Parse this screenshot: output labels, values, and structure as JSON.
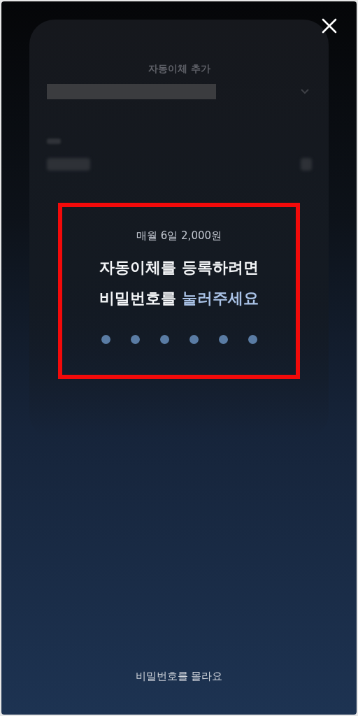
{
  "background_form": {
    "title": "자동이체 추가"
  },
  "pin_prompt": {
    "summary": "매월 6일 2,000원",
    "title_lines": [
      [
        {
          "text": "자동이체를 등록하려면",
          "accent": false
        }
      ],
      [
        {
          "text": "비밀번호를 ",
          "accent": false
        },
        {
          "text": "눌러주세요",
          "accent": true
        }
      ]
    ],
    "pin_dots": [
      {
        "filled": false
      },
      {
        "filled": false
      },
      {
        "filled": false
      },
      {
        "filled": false
      },
      {
        "filled": false
      },
      {
        "filled": false
      }
    ]
  },
  "forgot_link": "비밀번호를 몰라요"
}
